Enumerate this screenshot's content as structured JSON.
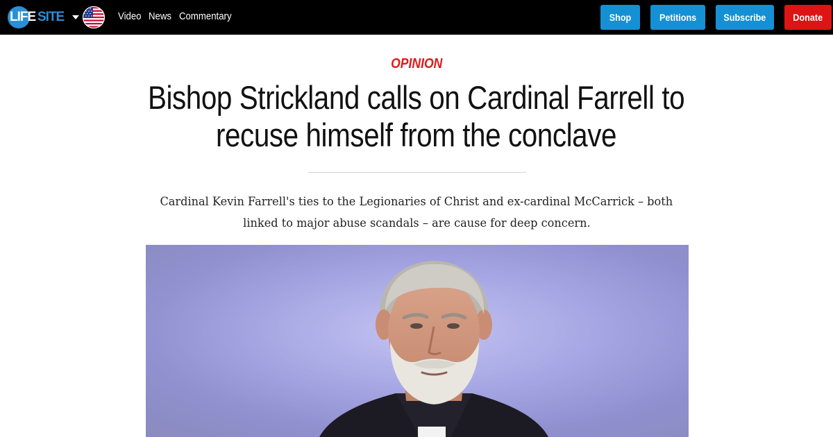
{
  "site": {
    "logo_left": "LIFE",
    "logo_right": "SITE",
    "region_icon": "us-flag-icon",
    "nav_links": [
      "Video",
      "News",
      "Commentary"
    ],
    "buttons": {
      "shop": "Shop",
      "petitions": "Petitions",
      "subscribe": "Subscribe",
      "donate": "Donate"
    },
    "colors": {
      "topbar": "#000000",
      "brand_blue": "#2a8fd6",
      "button_blue": "#1590d4",
      "donate_red": "#dd1414",
      "kicker_red": "#e01a1a"
    }
  },
  "article": {
    "kicker": "OPINION",
    "headline_line1": "Bishop Strickland calls on Cardinal Farrell to",
    "headline_line2": "recuse himself from the conclave",
    "dek_line1": "Cardinal Kevin Farrell's ties to the Legionaries of Christ and ex-cardinal McCarrick – both",
    "dek_line2": "linked to major abuse scandals – are cause for deep concern."
  }
}
